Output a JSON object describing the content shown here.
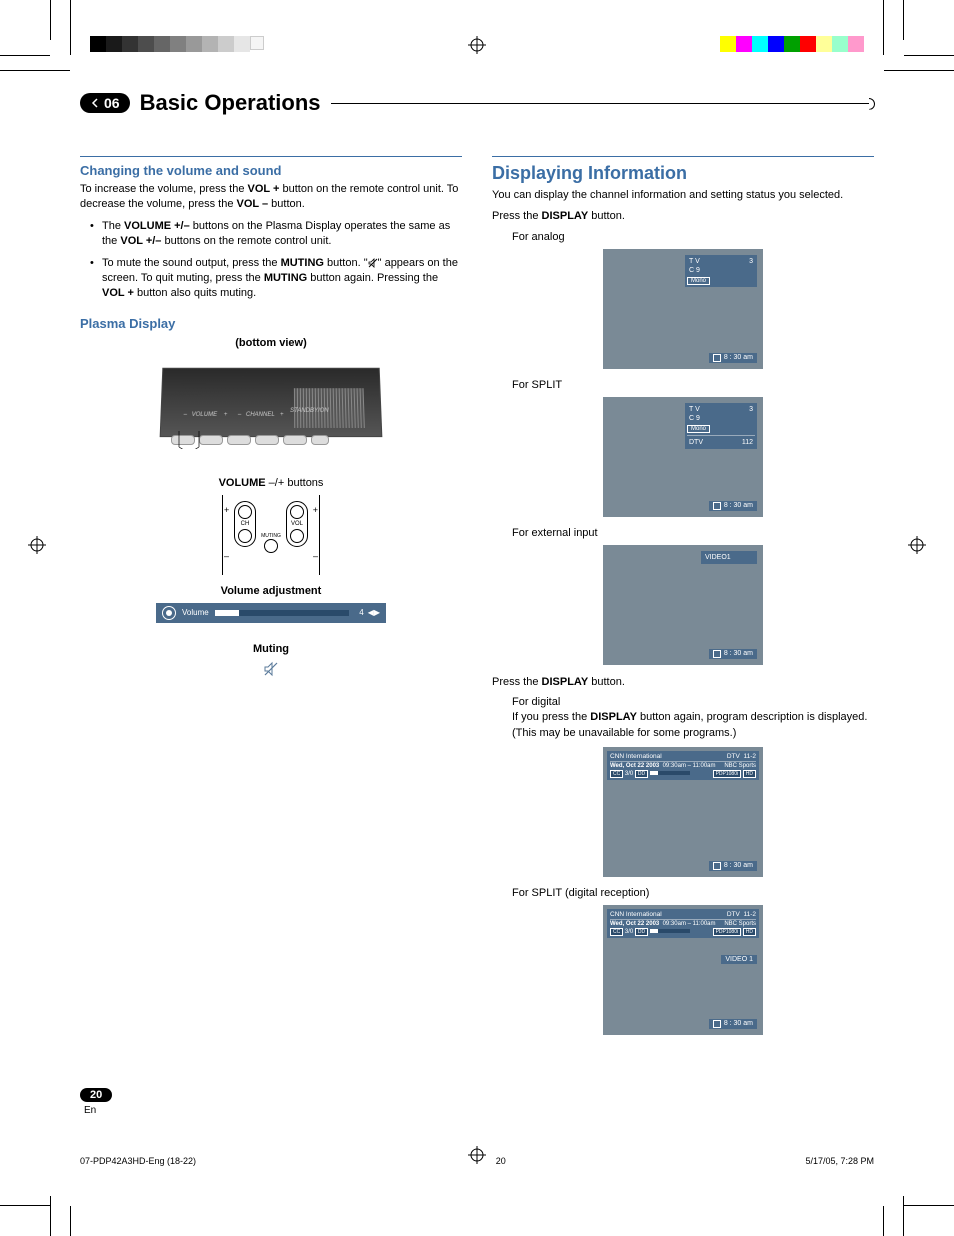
{
  "chapter": {
    "num": "06",
    "title": "Basic Operations"
  },
  "left": {
    "h_volume": "Changing the volume and sound",
    "p_volume_1a": "To increase the volume, press the ",
    "p_volume_1b": "VOL +",
    "p_volume_1c": " button on the remote control unit. To decrease the volume, press the ",
    "p_volume_1d": "VOL –",
    "p_volume_1e": " button.",
    "bullet1a": "The ",
    "bullet1b": "VOLUME +/–",
    "bullet1c": " buttons on the Plasma Display operates the same as the ",
    "bullet1d": "VOL +/–",
    "bullet1e": " buttons on the remote control unit.",
    "bullet2a": "To mute the sound output, press the ",
    "bullet2b": "MUTING",
    "bullet2c": " button. \"",
    "bullet2d": "\" appears on the screen. To quit muting, press the ",
    "bullet2e": "MUTING",
    "bullet2f": " button again. Pressing the ",
    "bullet2g": "VOL +",
    "bullet2h": " button also quits muting.",
    "h_plasma": "Plasma Display",
    "bottom_view": "(bottom view)",
    "panel_labels": {
      "vol": "VOLUME",
      "ch": "CHANNEL",
      "standby": "STANDBY/ON",
      "minus": "–",
      "plus": "+"
    },
    "vol_btn_caption_a": "VOLUME",
    "vol_btn_caption_b": " –/+ ",
    "vol_btn_caption_c": "buttons",
    "remote": {
      "ch": "CH",
      "vol": "VOL",
      "muting": "MUTING",
      "plus": "+",
      "minus": "–"
    },
    "h_voladj": "Volume adjustment",
    "volbar": {
      "label": "Volume",
      "value": "4"
    },
    "h_muting": "Muting"
  },
  "right": {
    "h_display": "Displaying Information",
    "p_display": "You can display the channel information and setting status you selected.",
    "press1a": "Press the ",
    "press1b": "DISPLAY",
    "press1c": " button.",
    "for_analog": "For analog",
    "analog": {
      "tv": "T V",
      "num": "3",
      "ch": "C 9",
      "mono": "Mono",
      "time": "8 : 30 am"
    },
    "for_split": "For SPLIT",
    "split": {
      "tv": "T V",
      "num": "3",
      "ch": "C 9",
      "mono": "Mono",
      "dtv": "DTV",
      "dtvnum": "112",
      "time": "8 : 30 am"
    },
    "for_ext": "For external input",
    "ext": {
      "label": "VIDEO1",
      "time": "8 : 30 am"
    },
    "press2a": "Press the ",
    "press2b": "DISPLAY",
    "press2c": " button.",
    "for_digital": "For digital",
    "digital_note_a": "If you press the ",
    "digital_note_b": "DISPLAY",
    "digital_note_c": " button again, program description is displayed.(This may be unavailable for some programs.)",
    "digital": {
      "prog": "CNN International",
      "dtv": "DTV",
      "chnum": "11-2",
      "date": "Wed, Oct 22 2003",
      "timespan": "09:30am – 11:00am",
      "src": "NBC Sports",
      "cc": "CC",
      "rating": "3/0",
      "dolby": "DD",
      "res": "PDP1080i",
      "hd": "HD",
      "time": "8 : 30 am"
    },
    "for_split_digital": "For SPLIT (digital reception)",
    "split_digital": {
      "video": "VIDEO 1",
      "time": "8 : 30 am"
    }
  },
  "footer": {
    "page": "20",
    "en": "En",
    "docname": "07-PDP42A3HD-Eng (18-22)",
    "pg": "20",
    "ts": "5/17/05, 7:28 PM"
  }
}
